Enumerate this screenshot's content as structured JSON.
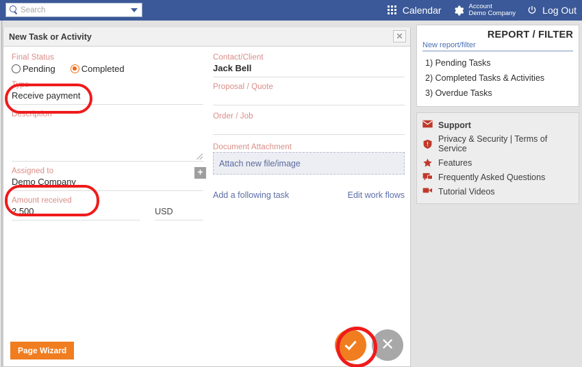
{
  "topnav": {
    "search": {
      "placeholder": "Search",
      "value": ""
    },
    "calendar_label": "Calendar",
    "account_line1": "Account",
    "account_line2": "Demo Company",
    "logout_label": "Log Out"
  },
  "dialog": {
    "title": "New Task or Activity",
    "close_label": "✕",
    "left": {
      "final_status_label": "Final Status",
      "radio_pending": "Pending",
      "radio_completed": "Completed",
      "selected_status": "Completed",
      "type_label": "Type",
      "type_value": "Receive payment",
      "description_label": "Description",
      "description_value": "",
      "assigned_label": "Assigned to",
      "assigned_value": "Demo Company",
      "assigned_add_label": "+",
      "amount_label": "Amount received",
      "amount_value": "2,500",
      "currency_value": "USD"
    },
    "right": {
      "contact_label": "Contact/Client",
      "contact_value": "Jack Bell",
      "proposal_label": "Proposal / Quote",
      "proposal_value": "",
      "order_label": "Order / Job",
      "order_value": "",
      "attachment_label": "Document Attachment",
      "attachment_action": "Attach new file/image",
      "link_following_task": "Add a following task",
      "link_edit_workflows": "Edit work flows"
    },
    "footer": {
      "page_wizard_label": "Page Wizard",
      "save_label": "✓",
      "cancel_label": "✕"
    }
  },
  "sidebar": {
    "report_panel": {
      "title": "REPORT / FILTER",
      "new_link": "New report/filter",
      "items": [
        "1) Pending Tasks",
        "2) Completed Tasks & Activities",
        "3) Overdue Tasks"
      ]
    },
    "support_panel": {
      "items": [
        {
          "label": "Support",
          "icon": "envelope-icon"
        },
        {
          "label": "Privacy & Security | Terms of Service",
          "icon": "shield-icon"
        },
        {
          "label": "Features",
          "icon": "star-icon"
        },
        {
          "label": "Frequently Asked Questions",
          "icon": "speech-bubble-icon"
        },
        {
          "label": "Tutorial Videos",
          "icon": "video-camera-icon"
        }
      ]
    }
  },
  "colors": {
    "navbar": "#3b5998",
    "accent_orange": "#f07d20",
    "label_salmon": "#d98c86",
    "annotation_red": "#ef1b1b",
    "support_red": "#c0392b",
    "link_blue": "#5c6ea8"
  }
}
